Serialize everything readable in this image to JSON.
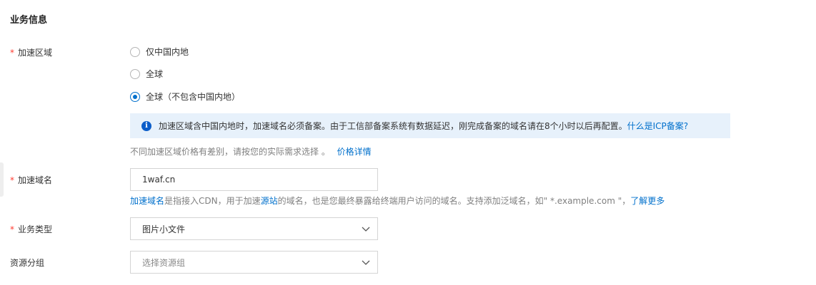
{
  "section": {
    "title": "业务信息"
  },
  "acceleration_region": {
    "label": "加速区域",
    "options": [
      {
        "label": "仅中国内地",
        "checked": false
      },
      {
        "label": "全球",
        "checked": false
      },
      {
        "label": "全球（不包含中国内地）",
        "checked": true
      }
    ],
    "notice_text": "加速区域含中国内地时，加速域名必须备案。由于工信部备案系统有数据延迟，刚完成备案的域名请在8个小时以后再配置。",
    "notice_link": "什么是ICP备案?",
    "price_hint": "不同加速区域价格有差别，请按您的实际需求选择 。",
    "price_link": "价格详情"
  },
  "domain": {
    "label": "加速域名",
    "value": "1waf.cn",
    "hint_link1": "加速域名",
    "hint_text1": "是指接入CDN，用于加速",
    "hint_link2": "源站",
    "hint_text2": "的域名，也是您最终暴露给终端用户访问的域名。支持添加泛域名，如\" *.example.com \"，",
    "hint_link3": "了解更多"
  },
  "business_type": {
    "label": "业务类型",
    "value": "图片小文件"
  },
  "resource_group": {
    "label": "资源分组",
    "placeholder": "选择资源组"
  },
  "colors": {
    "accent": "#0070cc",
    "required": "#ff3b30",
    "notice_bg": "#e7f1fb"
  }
}
